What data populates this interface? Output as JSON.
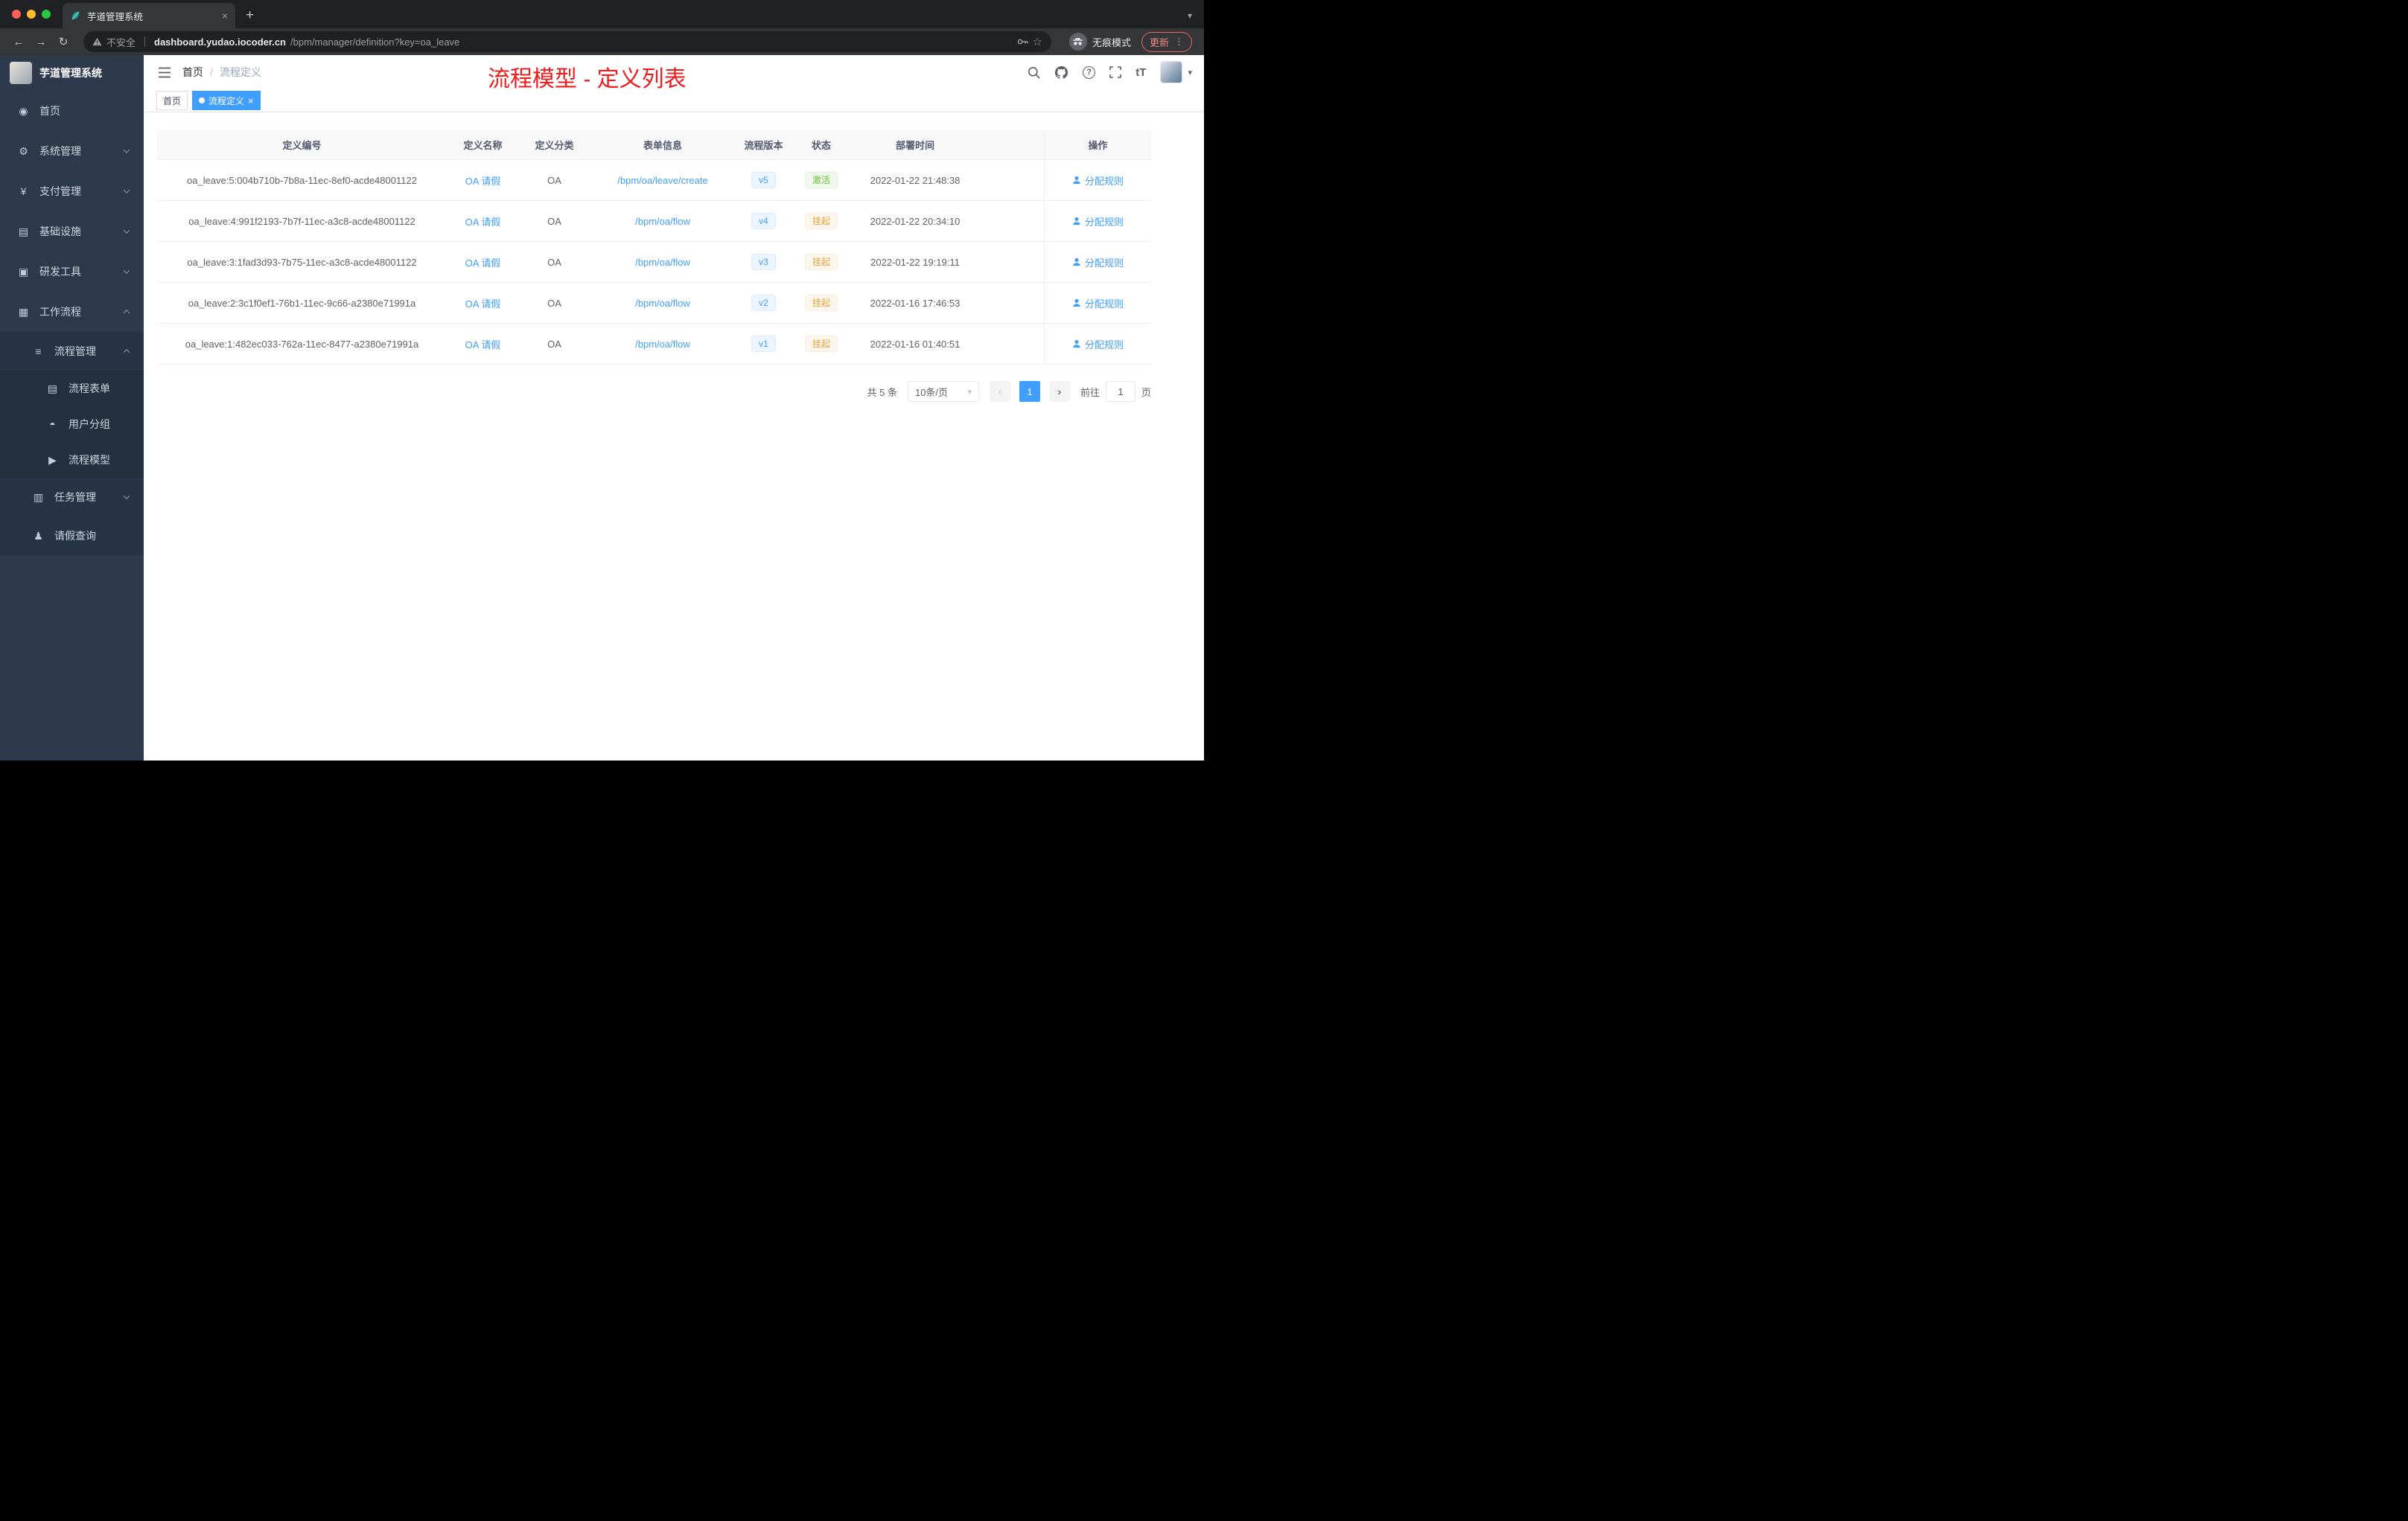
{
  "colors": {
    "accent": "#409eff",
    "success": "#67c23a",
    "warning": "#e6a23c",
    "title_red": "#ed1c1c",
    "sidebar_bg": "#2d3a4b"
  },
  "icons": {
    "back": "←",
    "forward": "→",
    "reload": "↻",
    "star": "☆",
    "menu_dots": "⋮",
    "new_tab": "+",
    "tab_close": "×",
    "chevron_down": "▾",
    "close": "×",
    "prev": "‹",
    "next": "›",
    "fontsize": "tT",
    "help": "?"
  },
  "browser": {
    "tab_title": "芋道管理系统",
    "security_label": "不安全",
    "url_host": "dashboard.yudao.iocoder.cn",
    "url_path": "/bpm/manager/definition?key=oa_leave",
    "incognito_label": "无痕模式",
    "update_label": "更新"
  },
  "sidebar": {
    "logo_title": "芋道管理系统",
    "items": [
      {
        "label": "首页",
        "icon": "◉"
      },
      {
        "label": "系统管理",
        "icon": "⚙"
      },
      {
        "label": "支付管理",
        "icon": "¥"
      },
      {
        "label": "基础设施",
        "icon": "▤"
      },
      {
        "label": "研发工具",
        "icon": "▣"
      },
      {
        "label": "工作流程",
        "icon": "▦"
      },
      {
        "label": "流程管理",
        "icon": "≡"
      },
      {
        "label": "流程表单",
        "icon": "▤"
      },
      {
        "label": "用户分组",
        "icon": "◓"
      },
      {
        "label": "流程模型",
        "icon": "▶"
      },
      {
        "label": "任务管理",
        "icon": "▥"
      },
      {
        "label": "请假查询",
        "icon": "♟"
      }
    ]
  },
  "header": {
    "breadcrumb_home": "首页",
    "breadcrumb_sep": "/",
    "breadcrumb_current": "流程定义",
    "overlay_title": "流程模型 - 定义列表"
  },
  "tags": {
    "home": "首页",
    "active": "流程定义"
  },
  "table": {
    "columns": [
      "定义编号",
      "定义名称",
      "定义分类",
      "表单信息",
      "流程版本",
      "状态",
      "部署时间",
      "操作"
    ],
    "rows": [
      {
        "id": "oa_leave:5:004b710b-7b8a-11ec-8ef0-acde48001122",
        "name": "OA 请假",
        "category": "OA",
        "form": "/bpm/oa/leave/create",
        "version": "v5",
        "status": "激活",
        "deploy_time": "2022-01-22 21:48:38",
        "action": "分配规则"
      },
      {
        "id": "oa_leave:4:991f2193-7b7f-11ec-a3c8-acde48001122",
        "name": "OA 请假",
        "category": "OA",
        "form": "/bpm/oa/flow",
        "version": "v4",
        "status": "挂起",
        "deploy_time": "2022-01-22 20:34:10",
        "action": "分配规则"
      },
      {
        "id": "oa_leave:3:1fad3d93-7b75-11ec-a3c8-acde48001122",
        "name": "OA 请假",
        "category": "OA",
        "form": "/bpm/oa/flow",
        "version": "v3",
        "status": "挂起",
        "deploy_time": "2022-01-22 19:19:11",
        "action": "分配规则"
      },
      {
        "id": "oa_leave:2:3c1f0ef1-76b1-11ec-9c66-a2380e71991a",
        "name": "OA 请假",
        "category": "OA",
        "form": "/bpm/oa/flow",
        "version": "v2",
        "status": "挂起",
        "deploy_time": "2022-01-16 17:46:53",
        "action": "分配规则"
      },
      {
        "id": "oa_leave:1:482ec033-762a-11ec-8477-a2380e71991a",
        "name": "OA 请假",
        "category": "OA",
        "form": "/bpm/oa/flow",
        "version": "v1",
        "status": "挂起",
        "deploy_time": "2022-01-16 01:40:51",
        "action": "分配规则"
      }
    ]
  },
  "pagination": {
    "total": "共 5 条",
    "page_size": "10条/页",
    "current_page": "1",
    "goto_label": "前往",
    "goto_value": "1",
    "unit": "页"
  }
}
